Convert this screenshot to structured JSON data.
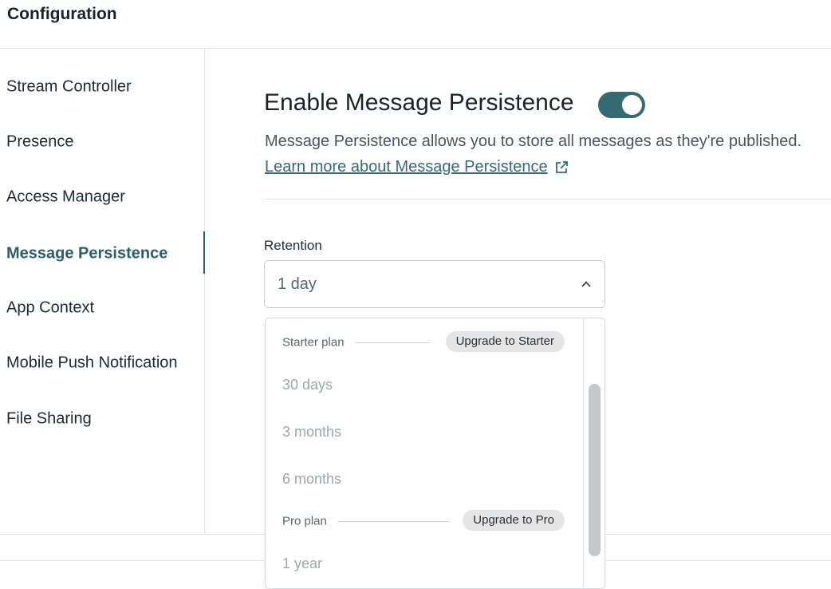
{
  "header": {
    "title": "Configuration"
  },
  "sidebar": {
    "items": [
      {
        "label": "Stream Controller"
      },
      {
        "label": "Presence"
      },
      {
        "label": "Access Manager"
      },
      {
        "label": "Message Persistence"
      },
      {
        "label": "App Context"
      },
      {
        "label": "Mobile Push Notification"
      },
      {
        "label": "File Sharing"
      }
    ],
    "active_index": 3
  },
  "main": {
    "section_title": "Enable Message Persistence",
    "toggle_on": true,
    "description": "Message Persistence allows you to store all messages as they're published.",
    "learn_more_link": "Learn more about Message Persistence",
    "retention_label": "Retention",
    "retention_value": "1 day",
    "dropdown": {
      "starter_group": {
        "label": "Starter plan",
        "upgrade_label": "Upgrade to Starter"
      },
      "starter_options": [
        "30 days",
        "3 months",
        "6 months"
      ],
      "pro_group": {
        "label": "Pro plan",
        "upgrade_label": "Upgrade to Pro"
      },
      "pro_options": [
        "1 year"
      ]
    }
  },
  "colors": {
    "accent": "#356a75",
    "active_text": "#2d5f6b",
    "disabled_option": "#a0a6aa"
  },
  "icons": {
    "external_link": "external-link-icon",
    "chevron": "chevron-up-icon"
  }
}
